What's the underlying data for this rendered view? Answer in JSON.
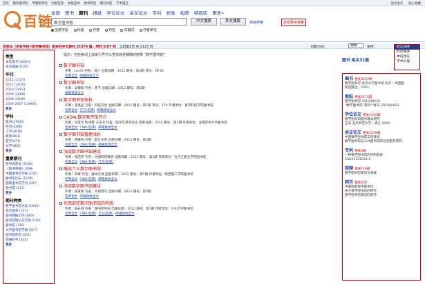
{
  "topbar": {
    "links": [
      "首页",
      "我的图书馆",
      "专题图书馆",
      "文献互助",
      "文献查询",
      "图书导航",
      "期刊导航",
      "学术报告"
    ],
    "right": [
      "设为主页",
      "加入收藏"
    ]
  },
  "logo": {
    "text": "百链"
  },
  "nav": {
    "tabs": [
      "全部",
      "图书",
      "期刊",
      "报纸",
      "学位论文",
      "会议论文",
      "专利",
      "标准",
      "视频",
      "特色库",
      "更多»"
    ],
    "active": 2
  },
  "search": {
    "value": "数字图书馆",
    "btn_cn": "中文搜索",
    "btn_foreign": "外文搜索",
    "advanced": "高级搜索",
    "within": "在结果中搜索",
    "radios": [
      "全部字段",
      "标题",
      "作者",
      "刊名",
      "关键词",
      "作者单位"
    ],
    "checked": 0
  },
  "resultbar": {
    "text": "找到与（所有字段=数字图书馆）相关的中文期刊 31074 篇，用时 0.07 秒",
    "pages": "当前第1页 共 2125 页",
    "group_label": "匹配方式：",
    "group_value": "模糊",
    "sort_label": "排序：",
    "sort_value": "默认排序"
  },
  "sort_options": [
    "默认排序",
    "时间降序",
    "本馆优先",
    "学术价值"
  ],
  "tip": "提示：在检索词上加单引号可以查找到更精确的结果 “数字图书馆”",
  "facets": [
    {
      "title": "类型",
      "items": [
        "本馆电子(30426)",
        "本馆纸质(1037)"
      ]
    },
    {
      "title": "年代",
      "items": [
        "2012 (1167)",
        "2011 (2610)",
        "2010 (2403)",
        "2009 (2468)",
        "2008 (2046)",
        "2000-2007 (15960)",
        "更多"
      ]
    },
    {
      "title": "学科",
      "items": [
        "图书(17925)",
        "经济(4266)",
        "工学(2876)",
        "教育(981)",
        "医学(671)",
        "文学(660)",
        "更多"
      ]
    },
    {
      "title": "重要期刊",
      "items": [
        "图书馆建设 (1426)",
        "《图书情报》(298)",
        "中国图书馆学报 (156)",
        "图书馆论坛 (1209)",
        "国家图书馆学刊 (297)",
        "图书馆 (217)",
        "更多"
      ]
    },
    {
      "title": "期刊种类",
      "items": [
        "数字图书馆论坛 (1045)",
        "现代图书 (157)",
        "图书情报工作 (893)",
        "图书馆理论与实践 (530)",
        "图书馆 (716)",
        "大学图书馆学报 (517)",
        "图书馆杂志 (651)",
        "情报科学 (456)",
        "更多"
      ]
    }
  ],
  "records": [
    {
      "title": "数字图书馆",
      "meta": "作者：Leslie 刊名：设计 出版日期：2012 期号：第4期 页码：60-61",
      "links": [
        "包库全文",
        "邮箱接收全文"
      ]
    },
    {
      "title": "数字图书馆",
      "meta": "作者：吴静毅 刊名：赤子 出版日期：2012 期号：第1期",
      "links": [
        "邮箱接收全文"
      ]
    },
    {
      "title": "数字图书馆探析",
      "meta": "作者：崔晶品 刊名：科技信息 出版日期：2012 期号：第1期 页码：474 作者单位：黄河科技学院图书馆",
      "links": [
        "包库全文",
        "万方(包库)",
        "邮箱接收全文"
      ]
    },
    {
      "title": "CADAL数字图书馆评介",
      "meta": "作者：毕宝华 陈诗慧 于志洋 刊名：医学信息学杂志 出版日期：2012 期号：第1期 作者单位：沈阳药科大学图书馆",
      "links": [
        "包库全文",
        "CNKI(包库)",
        "邮箱接收全文"
      ]
    },
    {
      "title": "数字图书馆管理浅析",
      "meta": "作者：杨嘉风 刊名：群文天地 出版日期：2012 期号：第2期",
      "links": [
        "包库全文",
        "CNKI(包库)",
        "邮箱接收全文"
      ]
    },
    {
      "title": "浅谈数字图书馆建设",
      "meta": "作者：张志玲 刊名：中国科技博览 出版日期：2012 期号：第2期 作者单位：牡丹江职业学院图书馆",
      "links": [
        "包库全文",
        "CNKI(包库)",
        "万方(包库)"
      ]
    },
    {
      "title": "略谈个人数字图书馆",
      "meta": "作者：刘峰 刊名：群文天地 出版日期：2012 期号：第1期 作者单位：陕西理工学院图书馆",
      "links": [
        "包库全文",
        "CNKI(包库)",
        "邮箱接收全文"
      ]
    },
    {
      "title": "浅谈数字图书馆建设",
      "meta": "作者：张爱民 刊名：大观周刊 出版日期：2012 期号：第3期",
      "links": [
        "包库全文",
        "邮箱接收全文"
      ]
    },
    {
      "title": "东西部区数字图书馆的构想",
      "meta": "作者：赵长城 刊名：图书馆学刊 出版日期：2012 期号：第1期 作者单位：兰州大学图书馆",
      "links": [
        "包库全文",
        "CNKI(包库)",
        "万方(包库)",
        "邮箱接收全文"
      ]
    }
  ],
  "right": {
    "paper_head": "图书 相关31篇",
    "groups": [
      {
        "head": "图书",
        "count": "相关3151种",
        "items": [
          "数字图书馆 北京大学图书馆 北京：中国国",
          "家出版社，2007。"
        ]
      },
      {
        "head": "报纸",
        "count": "相关2174篇",
        "items": [
          "数字图书馆 2010/06/28",
          "“数字图书馆”第四个春天 2010/04/22"
        ]
      },
      {
        "head": "学位论文",
        "count": "相关1299篇",
        "items": [
          "数字图书馆服务模式研究",
          "王涛 北京师范大学，硕士 2006."
        ]
      },
      {
        "head": "会议论文",
        "count": "相关2258篇",
        "items": [
          "中国数字图书馆工程建设",
          "数字图书馆与公共图书馆的信息服务研究"
        ]
      },
      {
        "head": "专利",
        "count": "相关4篇",
        "items": [
          "一种数字图书馆的控制系统",
          "CN101122051.A"
        ]
      },
      {
        "head": "视频",
        "count": "相关119部",
        "items": [
          "数字图书馆建设与发展"
        ]
      },
      {
        "head": "网页",
        "count": "相关信息",
        "items": [
          "中国国家数字图书馆",
          "关于数字图书馆的研究",
          "数字图书馆建设的趋势"
        ]
      }
    ]
  },
  "colors": {
    "accent": "#e8731a",
    "link": "#1a3fa8",
    "highlight": "#cc0000"
  }
}
